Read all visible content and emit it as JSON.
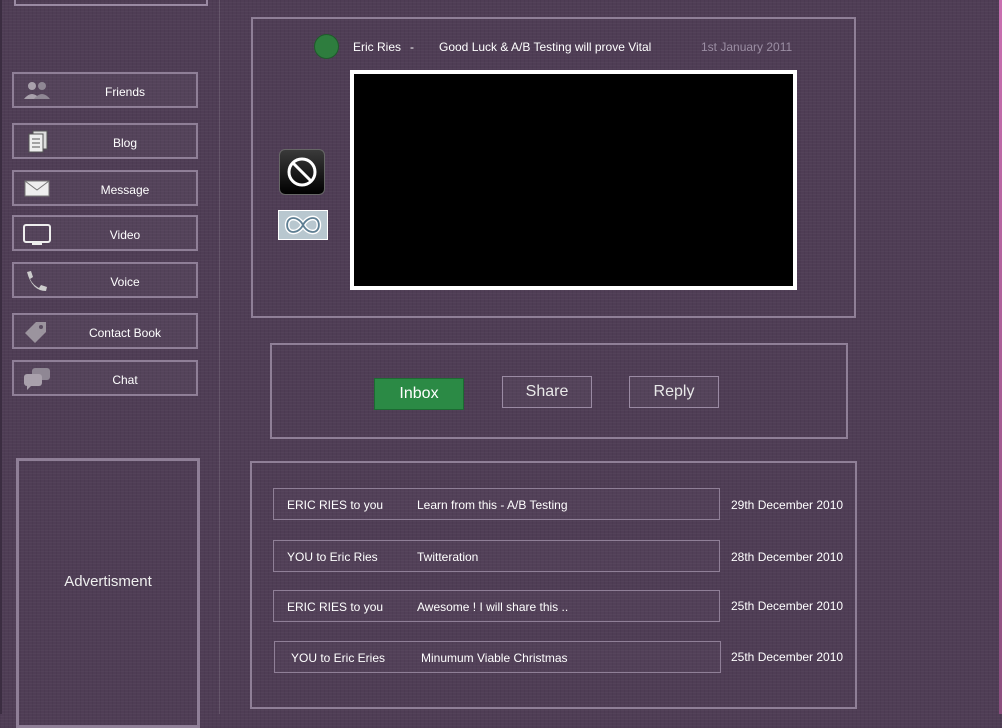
{
  "sidebar": {
    "items": [
      {
        "label": "Friends",
        "icon": "friends-icon"
      },
      {
        "label": "Blog",
        "icon": "blog-icon"
      },
      {
        "label": "Message",
        "icon": "envelope-icon"
      },
      {
        "label": "Video",
        "icon": "screen-icon"
      },
      {
        "label": "Voice",
        "icon": "phone-icon"
      },
      {
        "label": "Contact Book",
        "icon": "tag-icon"
      },
      {
        "label": "Chat",
        "icon": "chat-bubbles-icon"
      }
    ],
    "advertisement": "Advertisment"
  },
  "post": {
    "author": "Eric Ries",
    "separator": "-",
    "title": "Good Luck & A/B Testing will prove Vital",
    "date": "1st January 2011",
    "status_color": "#2e7d3e"
  },
  "actions": {
    "inbox": "Inbox",
    "share": "Share",
    "reply": "Reply",
    "active_color": "#2b8a45"
  },
  "messages": [
    {
      "from": "ERIC RIES to you",
      "subject": "Learn from this - A/B Testing",
      "date": "29th December 2010"
    },
    {
      "from": "YOU to Eric Ries",
      "subject": "Twitteration",
      "date": "28th December 2010"
    },
    {
      "from": "ERIC RIES to you",
      "subject": "Awesome ! I will share this ..",
      "date": "25th December 2010"
    },
    {
      "from": "YOU to Eric Eries",
      "subject": "Minumum Viable Christmas",
      "date": "25th December 2010"
    }
  ]
}
